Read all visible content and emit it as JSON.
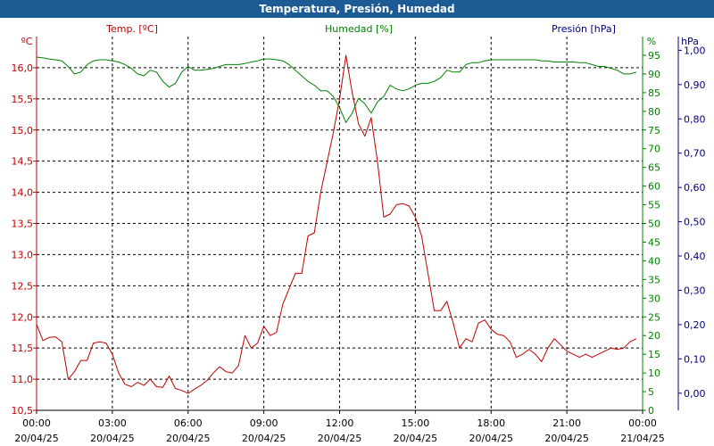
{
  "window": {
    "title": "Temperatura, Presión, Humedad"
  },
  "colors": {
    "temperature": "#c00000",
    "humidity": "#008000",
    "pressure": "#000080",
    "title_bg": "#1d5b94",
    "grid": "#000000"
  },
  "chart_data": {
    "type": "line",
    "title": "Temperatura, Presión, Humedad",
    "grid": true,
    "x_range": [
      "20/04/25 00:00",
      "21/04/25 00:00"
    ],
    "x_ticks": [
      {
        "time": "00:00",
        "date": "20/04/25"
      },
      {
        "time": "03:00",
        "date": "20/04/25"
      },
      {
        "time": "06:00",
        "date": "20/04/25"
      },
      {
        "time": "09:00",
        "date": "20/04/25"
      },
      {
        "time": "12:00",
        "date": "20/04/25"
      },
      {
        "time": "15:00",
        "date": "20/04/25"
      },
      {
        "time": "18:00",
        "date": "20/04/25"
      },
      {
        "time": "21:00",
        "date": "20/04/25"
      },
      {
        "time": "00:00",
        "date": "21/04/25"
      }
    ],
    "axes": {
      "temperature": {
        "label": "Temp. [ºC]",
        "unit": "ºC",
        "range": [
          10.5,
          16.5
        ],
        "ticks": [
          "10,5",
          "11,0",
          "11,5",
          "12,0",
          "12,5",
          "13,0",
          "13,5",
          "14,0",
          "14,5",
          "15,0",
          "15,5",
          "16,0"
        ]
      },
      "humidity": {
        "label": "Humedad [%]",
        "unit": "%",
        "range": [
          0,
          100
        ],
        "ticks": [
          "0",
          "5",
          "10",
          "15",
          "20",
          "25",
          "30",
          "35",
          "40",
          "45",
          "50",
          "55",
          "60",
          "65",
          "70",
          "75",
          "80",
          "85",
          "90",
          "95"
        ]
      },
      "pressure": {
        "label": "Presión [hPa]",
        "unit": "hPa",
        "range": [
          -0.05,
          1.04
        ],
        "ticks": [
          "0,00",
          "0,10",
          "0,20",
          "0,30",
          "0,40",
          "0,50",
          "0,60",
          "0,70",
          "0,80",
          "0,90",
          "1,00"
        ]
      }
    },
    "series": [
      {
        "name": "Temp. [ºC]",
        "axis": "temperature",
        "x": [
          "20/04/25 00:00",
          "20/04/25 00:15",
          "20/04/25 00:30",
          "20/04/25 00:45",
          "20/04/25 01:00",
          "20/04/25 01:15",
          "20/04/25 01:30",
          "20/04/25 01:45",
          "20/04/25 02:00",
          "20/04/25 02:15",
          "20/04/25 02:30",
          "20/04/25 02:45",
          "20/04/25 03:00",
          "20/04/25 03:15",
          "20/04/25 03:30",
          "20/04/25 03:45",
          "20/04/25 04:00",
          "20/04/25 04:15",
          "20/04/25 04:30",
          "20/04/25 04:45",
          "20/04/25 05:00",
          "20/04/25 05:15",
          "20/04/25 05:30",
          "20/04/25 05:45",
          "20/04/25 06:00",
          "20/04/25 06:15",
          "20/04/25 06:30",
          "20/04/25 06:45",
          "20/04/25 07:00",
          "20/04/25 07:15",
          "20/04/25 07:30",
          "20/04/25 07:45",
          "20/04/25 08:00",
          "20/04/25 08:15",
          "20/04/25 08:30",
          "20/04/25 08:45",
          "20/04/25 09:00",
          "20/04/25 09:15",
          "20/04/25 09:30",
          "20/04/25 09:45",
          "20/04/25 10:00",
          "20/04/25 10:15",
          "20/04/25 10:30",
          "20/04/25 10:45",
          "20/04/25 11:00",
          "20/04/25 11:15",
          "20/04/25 11:30",
          "20/04/25 11:45",
          "20/04/25 12:00",
          "20/04/25 12:15",
          "20/04/25 12:30",
          "20/04/25 12:45",
          "20/04/25 13:00",
          "20/04/25 13:15",
          "20/04/25 13:30",
          "20/04/25 13:45",
          "20/04/25 14:00",
          "20/04/25 14:15",
          "20/04/25 14:30",
          "20/04/25 14:45",
          "20/04/25 15:00",
          "20/04/25 15:15",
          "20/04/25 15:30",
          "20/04/25 15:45",
          "20/04/25 16:00",
          "20/04/25 16:15",
          "20/04/25 16:30",
          "20/04/25 16:45",
          "20/04/25 17:00",
          "20/04/25 17:15",
          "20/04/25 17:30",
          "20/04/25 17:45",
          "20/04/25 18:00",
          "20/04/25 18:15",
          "20/04/25 18:30",
          "20/04/25 18:45",
          "20/04/25 19:00",
          "20/04/25 19:15",
          "20/04/25 19:30",
          "20/04/25 19:45",
          "20/04/25 20:00",
          "20/04/25 20:15",
          "20/04/25 20:30",
          "20/04/25 20:45",
          "20/04/25 21:00",
          "20/04/25 21:15",
          "20/04/25 21:30",
          "20/04/25 21:45",
          "20/04/25 22:00",
          "20/04/25 22:15",
          "20/04/25 22:30",
          "20/04/25 22:45",
          "20/04/25 23:00",
          "20/04/25 23:15",
          "20/04/25 23:30",
          "20/04/25 23:45"
        ],
        "values": [
          11.88,
          11.62,
          11.67,
          11.68,
          11.6,
          11.0,
          11.12,
          11.3,
          11.3,
          11.58,
          11.6,
          11.58,
          11.4,
          11.1,
          10.92,
          10.88,
          10.95,
          10.9,
          11.0,
          10.88,
          10.87,
          11.05,
          10.85,
          10.82,
          10.77,
          10.84,
          10.9,
          10.98,
          11.1,
          11.2,
          11.12,
          11.1,
          11.22,
          11.7,
          11.5,
          11.58,
          11.85,
          11.7,
          11.75,
          12.2,
          12.45,
          12.7,
          12.7,
          13.3,
          13.35,
          14.0,
          14.48,
          14.95,
          15.5,
          16.2,
          15.6,
          15.1,
          14.9,
          15.2,
          14.5,
          13.6,
          13.65,
          13.8,
          13.82,
          13.78,
          13.6,
          13.3,
          12.7,
          12.1,
          12.1,
          12.25,
          11.9,
          11.5,
          11.65,
          11.6,
          11.9,
          11.95,
          11.8,
          11.72,
          11.7,
          11.6,
          11.35,
          11.4,
          11.48,
          11.4,
          11.28,
          11.5,
          11.65,
          11.55,
          11.45,
          11.4,
          11.35,
          11.4,
          11.35,
          11.4,
          11.45,
          11.5,
          11.48,
          11.5,
          11.6,
          11.65
        ]
      },
      {
        "name": "Humedad [%]",
        "axis": "humidity",
        "x": [
          "20/04/25 00:00",
          "20/04/25 00:15",
          "20/04/25 00:30",
          "20/04/25 00:45",
          "20/04/25 01:00",
          "20/04/25 01:15",
          "20/04/25 01:30",
          "20/04/25 01:45",
          "20/04/25 02:00",
          "20/04/25 02:15",
          "20/04/25 02:30",
          "20/04/25 02:45",
          "20/04/25 03:00",
          "20/04/25 03:15",
          "20/04/25 03:30",
          "20/04/25 03:45",
          "20/04/25 04:00",
          "20/04/25 04:15",
          "20/04/25 04:30",
          "20/04/25 04:45",
          "20/04/25 05:00",
          "20/04/25 05:15",
          "20/04/25 05:30",
          "20/04/25 05:45",
          "20/04/25 06:00",
          "20/04/25 06:15",
          "20/04/25 06:30",
          "20/04/25 06:45",
          "20/04/25 07:00",
          "20/04/25 07:15",
          "20/04/25 07:30",
          "20/04/25 07:45",
          "20/04/25 08:00",
          "20/04/25 08:15",
          "20/04/25 08:30",
          "20/04/25 08:45",
          "20/04/25 09:00",
          "20/04/25 09:15",
          "20/04/25 09:30",
          "20/04/25 09:45",
          "20/04/25 10:00",
          "20/04/25 10:15",
          "20/04/25 10:30",
          "20/04/25 10:45",
          "20/04/25 11:00",
          "20/04/25 11:15",
          "20/04/25 11:30",
          "20/04/25 11:45",
          "20/04/25 12:00",
          "20/04/25 12:15",
          "20/04/25 12:30",
          "20/04/25 12:45",
          "20/04/25 13:00",
          "20/04/25 13:15",
          "20/04/25 13:30",
          "20/04/25 13:45",
          "20/04/25 14:00",
          "20/04/25 14:15",
          "20/04/25 14:30",
          "20/04/25 14:45",
          "20/04/25 15:00",
          "20/04/25 15:15",
          "20/04/25 15:30",
          "20/04/25 15:45",
          "20/04/25 16:00",
          "20/04/25 16:15",
          "20/04/25 16:30",
          "20/04/25 16:45",
          "20/04/25 17:00",
          "20/04/25 17:15",
          "20/04/25 17:30",
          "20/04/25 17:45",
          "20/04/25 18:00",
          "20/04/25 18:15",
          "20/04/25 18:30",
          "20/04/25 18:45",
          "20/04/25 19:00",
          "20/04/25 19:15",
          "20/04/25 19:30",
          "20/04/25 19:45",
          "20/04/25 20:00",
          "20/04/25 20:15",
          "20/04/25 20:30",
          "20/04/25 20:45",
          "20/04/25 21:00",
          "20/04/25 21:15",
          "20/04/25 21:30",
          "20/04/25 21:45",
          "20/04/25 22:00",
          "20/04/25 22:15",
          "20/04/25 22:30",
          "20/04/25 22:45",
          "20/04/25 23:00",
          "20/04/25 23:15",
          "20/04/25 23:30",
          "20/04/25 23:45"
        ],
        "values": [
          94.5,
          94.3,
          94.0,
          93.8,
          93.5,
          92.0,
          90.0,
          90.5,
          92.5,
          93.5,
          93.8,
          93.8,
          93.5,
          93.2,
          92.5,
          91.5,
          90.0,
          89.5,
          91.0,
          90.5,
          88.0,
          86.5,
          87.5,
          90.5,
          92.0,
          91.0,
          91.0,
          91.2,
          91.5,
          92.0,
          92.5,
          92.5,
          92.5,
          92.8,
          93.2,
          93.5,
          94.0,
          94.0,
          93.8,
          93.5,
          92.5,
          91.0,
          89.5,
          88.0,
          87.0,
          85.5,
          85.5,
          84.0,
          81.0,
          77.0,
          79.5,
          83.5,
          82.0,
          79.5,
          82.5,
          84.0,
          87.0,
          86.0,
          85.5,
          86.0,
          87.0,
          87.5,
          87.5,
          88.0,
          89.0,
          91.0,
          90.5,
          90.5,
          92.5,
          93.0,
          93.0,
          93.5,
          93.8,
          93.8,
          93.8,
          93.8,
          93.8,
          93.8,
          93.8,
          93.8,
          93.5,
          93.5,
          93.2,
          93.2,
          93.2,
          93.2,
          93.0,
          93.0,
          92.5,
          92.0,
          92.0,
          91.5,
          91.0,
          90.0,
          90.0,
          90.5
        ]
      },
      {
        "name": "Presión [hPa]",
        "axis": "pressure",
        "x": [],
        "values": []
      }
    ]
  }
}
